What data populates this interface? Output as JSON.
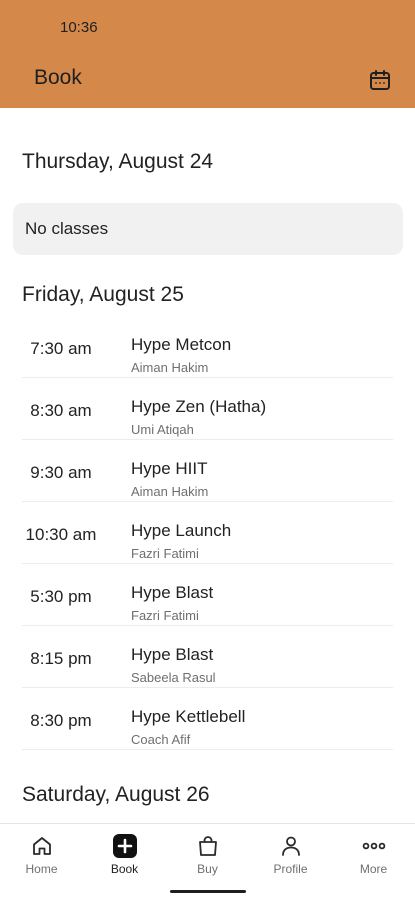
{
  "status_bar": {
    "time": "10:36"
  },
  "header": {
    "title": "Book",
    "calendar_icon": "calendar-icon",
    "background": "#d4894a"
  },
  "days": [
    {
      "heading": "Thursday, August 24",
      "empty_text": "No classes"
    },
    {
      "heading": "Friday, August 25",
      "classes": [
        {
          "time": "7:30 am",
          "name": "Hype Metcon",
          "coach": "Aiman Hakim"
        },
        {
          "time": "8:30 am",
          "name": "Hype Zen (Hatha)",
          "coach": "Umi Atiqah"
        },
        {
          "time": "9:30 am",
          "name": "Hype HIIT",
          "coach": "Aiman Hakim"
        },
        {
          "time": "10:30 am",
          "name": "Hype Launch",
          "coach": "Fazri Fatimi"
        },
        {
          "time": "5:30 pm",
          "name": "Hype Blast",
          "coach": "Fazri Fatimi"
        },
        {
          "time": "8:15 pm",
          "name": "Hype Blast",
          "coach": "Sabeela Rasul"
        },
        {
          "time": "8:30 pm",
          "name": "Hype Kettlebell",
          "coach": "Coach Afif"
        }
      ]
    },
    {
      "heading": "Saturday, August 26"
    }
  ],
  "tabbar": {
    "active": "Book",
    "tabs": [
      {
        "label": "Home",
        "icon": "home-icon"
      },
      {
        "label": "Book",
        "icon": "plus-square-icon"
      },
      {
        "label": "Buy",
        "icon": "shopping-bag-icon"
      },
      {
        "label": "Profile",
        "icon": "person-icon"
      },
      {
        "label": "More",
        "icon": "more-dots-icon"
      }
    ]
  }
}
